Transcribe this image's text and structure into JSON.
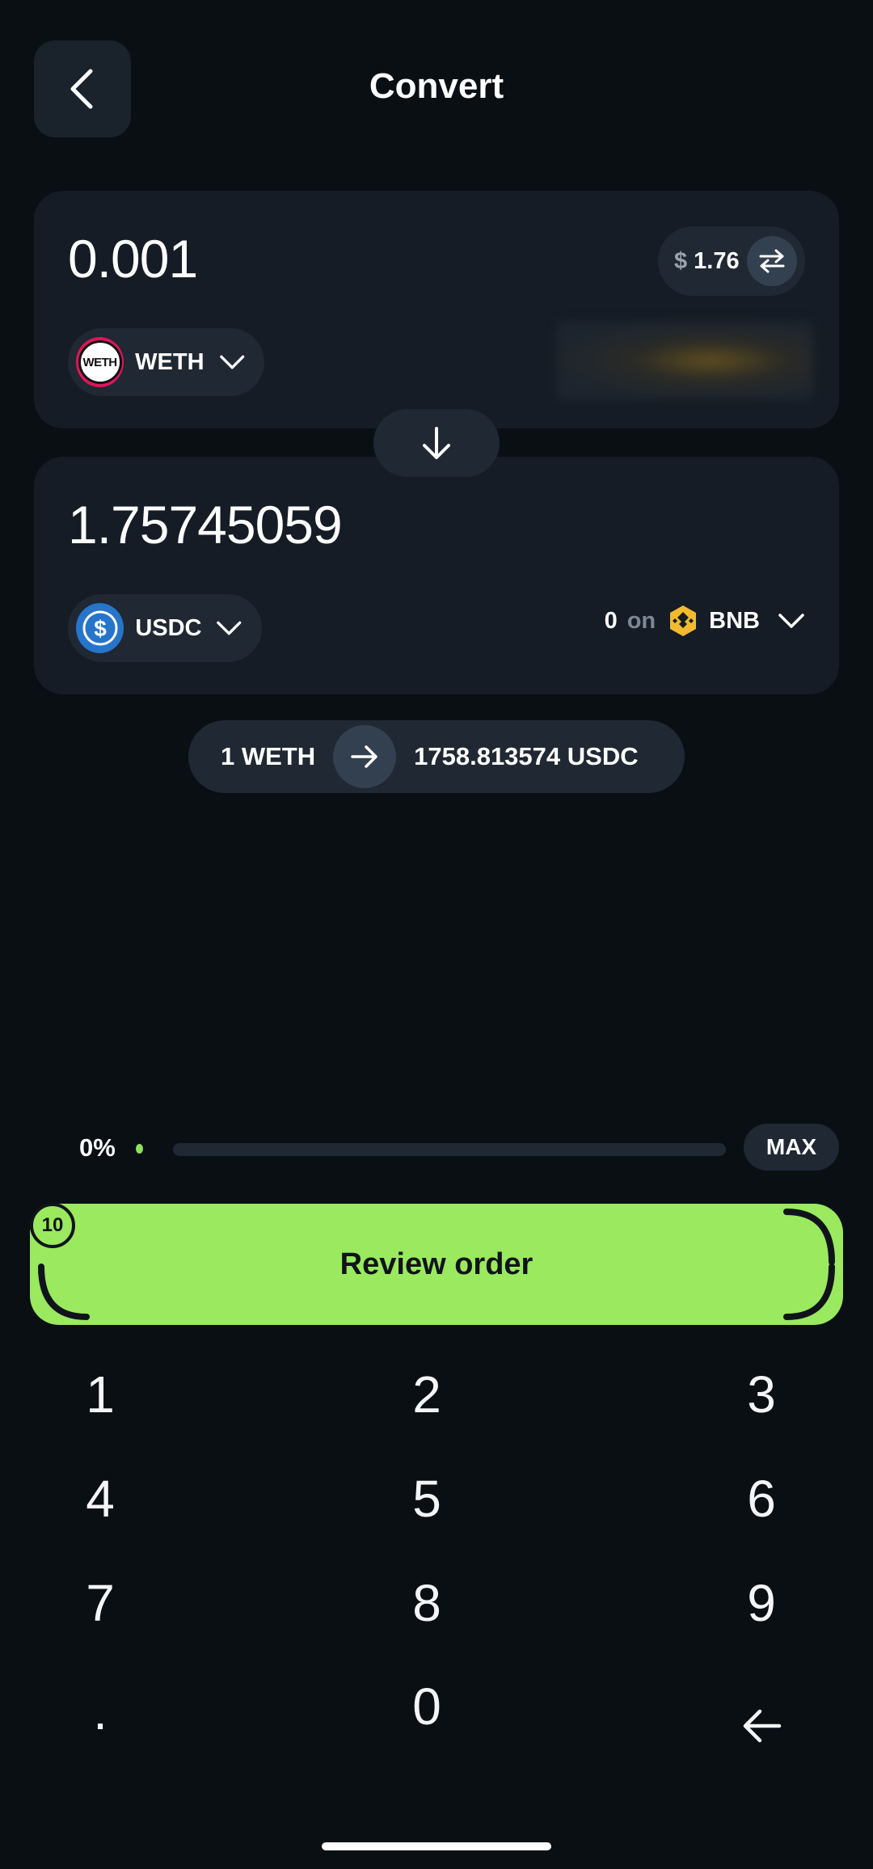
{
  "header": {
    "title": "Convert"
  },
  "from": {
    "amount": "0.001",
    "usd_symbol": "$",
    "usd_value": "1.76",
    "token": "WETH",
    "token_logo_text": "WETH"
  },
  "to": {
    "amount": "1.75745059",
    "token": "USDC",
    "balance": "0",
    "on_label": "on",
    "chain": "BNB"
  },
  "rate": {
    "from": "1 WETH",
    "to": "1758.813574 USDC"
  },
  "slider": {
    "percent_label": "0%",
    "value": 0,
    "max_label": "MAX"
  },
  "review": {
    "label": "Review order",
    "badge": "10"
  },
  "keypad": [
    "1",
    "2",
    "3",
    "4",
    "5",
    "6",
    "7",
    "8",
    "9",
    ".",
    "0",
    "backspace"
  ],
  "colors": {
    "accent": "#9ae95f",
    "background": "#0a0f14",
    "card": "#151c25",
    "pill": "#1f2833",
    "bnb": "#f3ba2f",
    "usdc": "#2775ca",
    "weth": "#e1155a"
  }
}
